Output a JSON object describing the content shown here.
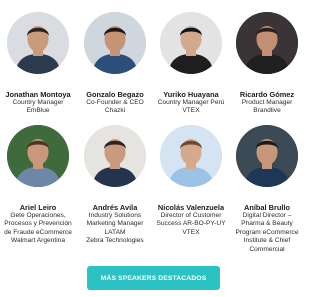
{
  "speakers": [
    {
      "name": "Jonathan Montoya",
      "role": [
        "Country Manager",
        "EmBlue"
      ],
      "bg": "#d9dde2",
      "skin": "#c99a7c",
      "hair": "#2d2420",
      "shirt": "#2c3a4e"
    },
    {
      "name": "Gonzalo Begazo",
      "role": [
        "Co-Founder & CEO",
        "Chazki"
      ],
      "bg": "#cfd6dd",
      "skin": "#c49474",
      "hair": "#1f1a18",
      "shirt": "#2b4f7a"
    },
    {
      "name": "Yuriko Huayana",
      "role": [
        "Country Manager Perú",
        "VTEX"
      ],
      "bg": "#e3e3e3",
      "skin": "#d3a98d",
      "hair": "#151414",
      "shirt": "#1e1e1e"
    },
    {
      "name": "Ricardo Gómez",
      "role": [
        "Product Manager",
        "Brandlive"
      ],
      "bg": "#3a3436",
      "skin": "#c38f72",
      "hair": "#2a1f1a",
      "shirt": "#202020"
    },
    {
      "name": "Ariel Leiro",
      "role": [
        "Gete Operaciones,",
        "Procesos y Prevención",
        "de Fraude eCommerce",
        "Walmart Argentina"
      ],
      "bg": "#3f6b3c",
      "skin": "#c9987a",
      "hair": "#4a3526",
      "shirt": "#6f87a6"
    },
    {
      "name": "Andrés Avila",
      "role": [
        "Industry Solutions",
        "Marketing Manager",
        "LATAM",
        "Zebra Technologies"
      ],
      "bg": "#e6e4e1",
      "skin": "#c99b7e",
      "hair": "#2b2320",
      "shirt": "#23344d"
    },
    {
      "name": "Nicolás Valenzuela",
      "role": [
        "Director of Customer",
        "Success AR-BO-PY-UY",
        "VTEX"
      ],
      "bg": "#d4e4f2",
      "skin": "#d5a98a",
      "hair": "#6b4a30",
      "shirt": "#9cc3e6"
    },
    {
      "name": "Aníbal Brullo",
      "role": [
        "Digital Director –",
        "Pharma & Beauty",
        "Program eCommerce",
        "Institute & Chief",
        "Commercial"
      ],
      "bg": "#3c4a55",
      "skin": "#c7977a",
      "hair": "#1d1a19",
      "shirt": "#1d3757"
    }
  ],
  "cta": {
    "label": "MÁS SPEAKERS DESTACADOS",
    "color": "#2bc2c4"
  }
}
